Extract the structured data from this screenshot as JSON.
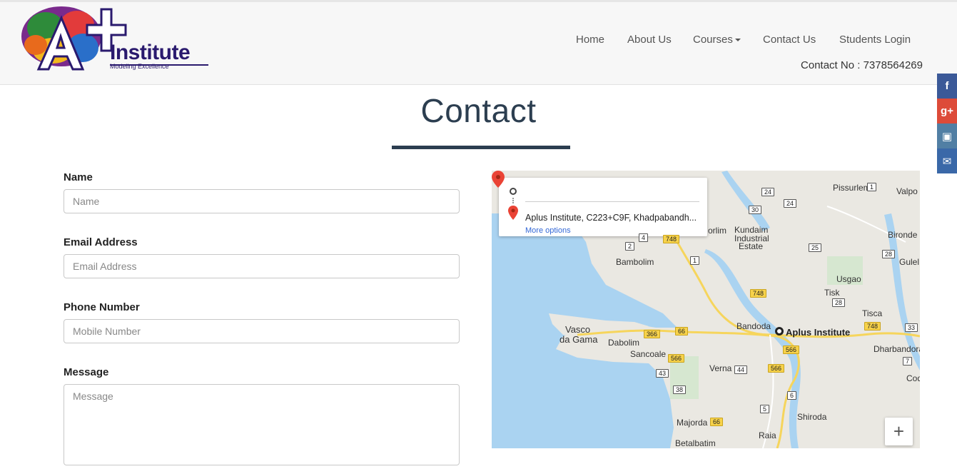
{
  "logo": {
    "main": "A+",
    "word": "Institute",
    "tagline": "Modeling Excellence"
  },
  "nav": {
    "items": [
      {
        "label": "Home"
      },
      {
        "label": "About Us"
      },
      {
        "label": "Courses"
      },
      {
        "label": "Contact Us"
      },
      {
        "label": "Students Login"
      }
    ],
    "contact_no": "Contact No : 7378564269"
  },
  "social": {
    "facebook": "f",
    "google_plus": "g+",
    "instagram": "▣",
    "email": "✉",
    "colors": {
      "facebook": "#3b5998",
      "google_plus": "#dd4b39",
      "instagram": "#517fa4",
      "email": "#3a68a8"
    }
  },
  "page": {
    "heading": "Contact"
  },
  "form": {
    "name_label": "Name",
    "name_placeholder": "Name",
    "email_label": "Email Address",
    "email_placeholder": "Email Address",
    "phone_label": "Phone Number",
    "phone_placeholder": "Mobile Number",
    "message_label": "Message",
    "message_placeholder": "Message"
  },
  "map": {
    "destination": "Aplus Institute, C223+C9F, Khadpabandh...",
    "more_options": "More options",
    "place_name": "Aplus Institute",
    "zoom_in": "+",
    "labels": {
      "pissurlem": "Pissurlem",
      "valpoi": "Valpo",
      "kundaim": "Kundaim",
      "industrial": "Industrial",
      "estate": "Estate",
      "orlim": "orlim",
      "bironde": "Bironde",
      "gulel": "Gulel",
      "bambolim": "Bambolim",
      "usgao": "Usgao",
      "tisk": "Tisk",
      "tisca": "Tisca",
      "bandoda": "Bandoda",
      "vasco": "Vasco",
      "da_gama": "da Gama",
      "dabolim": "Dabolim",
      "sancoale": "Sancoale",
      "verna": "Verna",
      "dharbandora": "Dharbandora",
      "cod": "Cod",
      "shiroda": "Shiroda",
      "majorda": "Majorda",
      "raia": "Raia",
      "betalbatim": "Betalbatim"
    },
    "shields": {
      "s24a": "24",
      "s24b": "24",
      "s30": "30",
      "s1a": "1",
      "s1b": "1",
      "s2": "2",
      "s4": "4",
      "s25": "25",
      "s28a": "28",
      "s28b": "28",
      "s748a": "748",
      "s748b": "748",
      "s748c": "748",
      "s33": "33",
      "s366": "366",
      "s66a": "66",
      "s66b": "66",
      "s566a": "566",
      "s566b": "566",
      "s566c": "566",
      "s43": "43",
      "s44": "44",
      "s38": "38",
      "s6": "6",
      "s5": "5",
      "s7": "7"
    }
  }
}
